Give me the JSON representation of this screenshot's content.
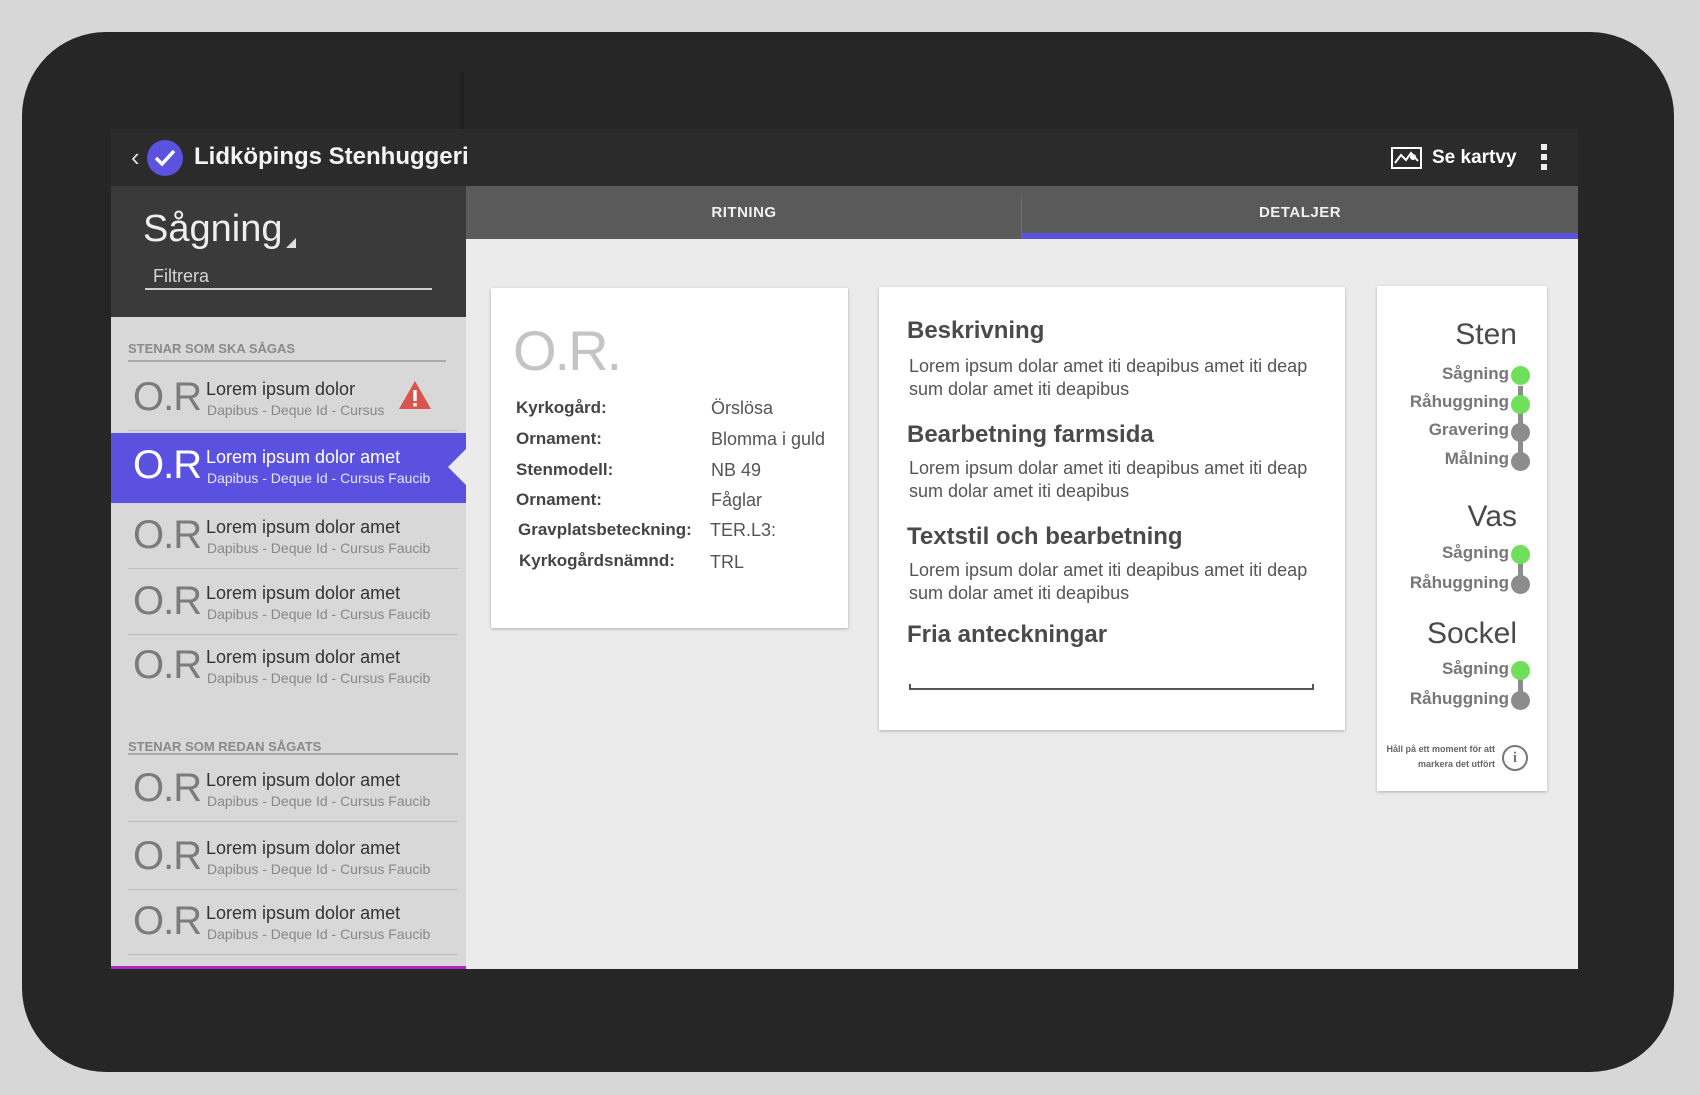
{
  "app": {
    "title": "Lidköpings Stenhuggeri",
    "map_label": "Se kartvy"
  },
  "sidebar": {
    "spinner": "Sågning",
    "filter_placeholder": "Filtrera",
    "section_todo": "STENAR SOM SKA SÅGAS",
    "section_done": "STENAR SOM REDAN SÅGATS",
    "todo_items": [
      {
        "id": "O.R",
        "title": "Lorem ipsum dolor",
        "sub": "Dapibus - Deque Id - Cursus",
        "warning": true
      },
      {
        "id": "O.R",
        "title": "Lorem ipsum dolor amet",
        "sub": "Dapibus - Deque Id - Cursus Faucib",
        "active": true
      },
      {
        "id": "O.R",
        "title": "Lorem ipsum dolor amet",
        "sub": "Dapibus - Deque Id - Cursus Faucib"
      },
      {
        "id": "O.R",
        "title": "Lorem ipsum dolor amet",
        "sub": "Dapibus - Deque Id - Cursus Faucib"
      },
      {
        "id": "O.R",
        "title": "Lorem ipsum dolor amet",
        "sub": "Dapibus - Deque Id - Cursus Faucib"
      }
    ],
    "done_items": [
      {
        "id": "O.R",
        "title": "Lorem ipsum dolor amet",
        "sub": "Dapibus - Deque Id - Cursus Faucib"
      },
      {
        "id": "O.R",
        "title": "Lorem ipsum dolor amet",
        "sub": "Dapibus - Deque Id - Cursus Faucib"
      },
      {
        "id": "O.R",
        "title": "Lorem ipsum dolor amet",
        "sub": "Dapibus - Deque Id - Cursus Faucib"
      }
    ]
  },
  "tabs": [
    {
      "label": "RITNING"
    },
    {
      "label": "DETALJER",
      "selected": true
    }
  ],
  "details": {
    "id": "O.R.",
    "rows": [
      {
        "label": "Kyrkogård:",
        "value": "Örslösa"
      },
      {
        "label": "Ornament:",
        "value": "Blomma i guld"
      },
      {
        "label": "Stenmodell:",
        "value": "NB 49"
      },
      {
        "label": "Ornament:",
        "value": "Fåglar"
      },
      {
        "label": "Gravplatsbeteckning:",
        "value": "TER.L3:"
      },
      {
        "label": "Kyrkogårdsnämnd:",
        "value": "TRL"
      }
    ]
  },
  "description": {
    "sections": [
      {
        "heading": "Beskrivning",
        "text": "Lorem ipsum dolar amet iti deapibus amet iti deap sum dolar amet iti deapibus"
      },
      {
        "heading": "Bearbetning farmsida",
        "text": "Lorem ipsum dolar amet iti deapibus amet iti deap sum dolar amet iti deapibus"
      },
      {
        "heading": "Textstil och bearbetning",
        "text": "Lorem ipsum dolar amet iti deapibus amet iti deap sum dolar amet iti deapibus"
      }
    ],
    "notes_heading": "Fria anteckningar"
  },
  "status": {
    "colors": {
      "done": "#6ee05a",
      "pending": "#8c8c8c"
    },
    "groups": [
      {
        "name": "Sten",
        "steps": [
          {
            "label": "Sågning",
            "done": true
          },
          {
            "label": "Råhuggning",
            "done": true
          },
          {
            "label": "Gravering",
            "done": false
          },
          {
            "label": "Målning",
            "done": false
          }
        ]
      },
      {
        "name": "Vas",
        "steps": [
          {
            "label": "Sågning",
            "done": true
          },
          {
            "label": "Råhuggning",
            "done": false
          }
        ]
      },
      {
        "name": "Sockel",
        "steps": [
          {
            "label": "Sågning",
            "done": true
          },
          {
            "label": "Råhuggning",
            "done": false
          }
        ]
      }
    ],
    "hint": "Håll på ett moment för att markera det utfört"
  },
  "accent_color": "#5a51e0",
  "icons": {
    "back": "back-arrow-icon",
    "logo": "checkmark-logo-icon",
    "map": "map-icon",
    "overflow": "overflow-menu-icon",
    "warning": "warning-icon",
    "info": "info-icon"
  }
}
